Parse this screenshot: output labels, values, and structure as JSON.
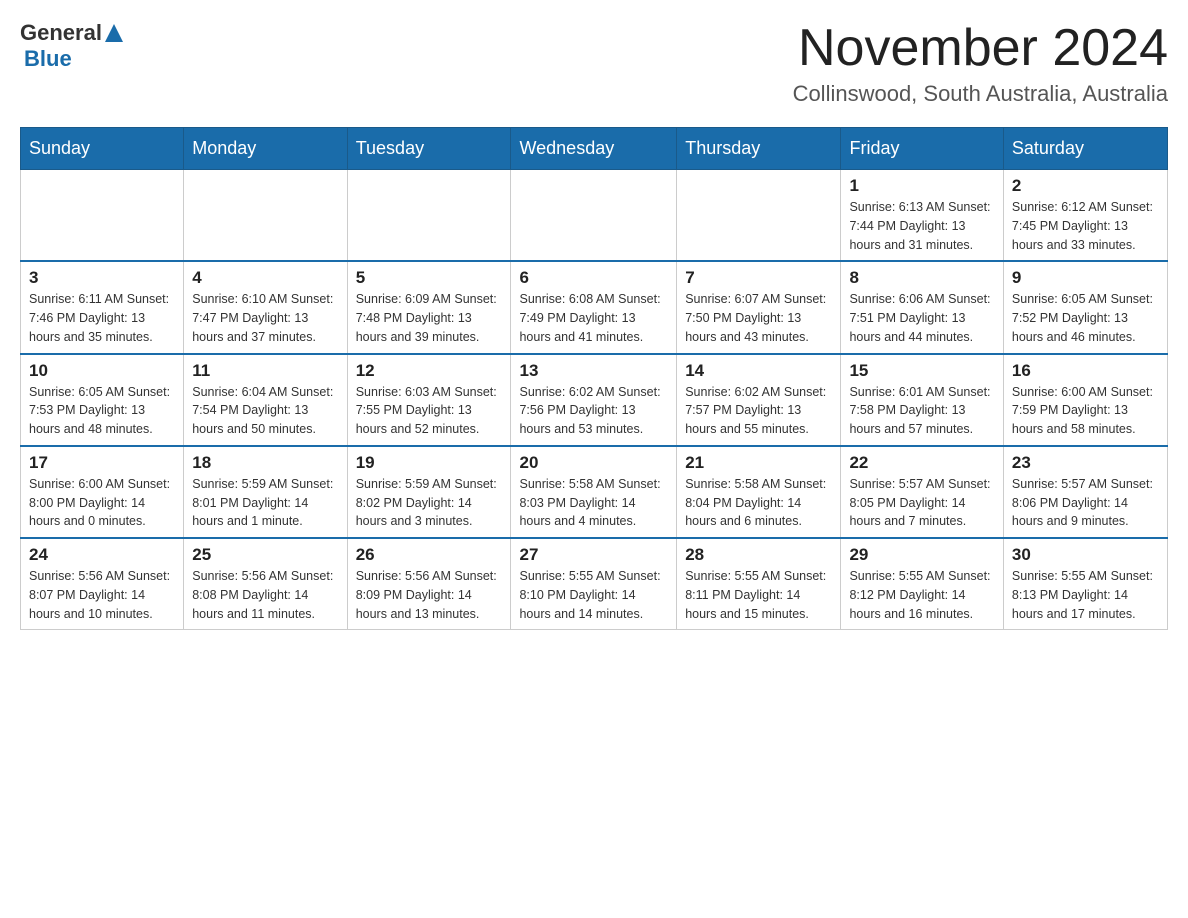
{
  "logo": {
    "general": "General",
    "triangle": "▶",
    "blue": "Blue"
  },
  "title": "November 2024",
  "location": "Collinswood, South Australia, Australia",
  "days_header": [
    "Sunday",
    "Monday",
    "Tuesday",
    "Wednesday",
    "Thursday",
    "Friday",
    "Saturday"
  ],
  "weeks": [
    {
      "cells": [
        {
          "day": "",
          "info": ""
        },
        {
          "day": "",
          "info": ""
        },
        {
          "day": "",
          "info": ""
        },
        {
          "day": "",
          "info": ""
        },
        {
          "day": "",
          "info": ""
        },
        {
          "day": "1",
          "info": "Sunrise: 6:13 AM\nSunset: 7:44 PM\nDaylight: 13 hours\nand 31 minutes."
        },
        {
          "day": "2",
          "info": "Sunrise: 6:12 AM\nSunset: 7:45 PM\nDaylight: 13 hours\nand 33 minutes."
        }
      ]
    },
    {
      "cells": [
        {
          "day": "3",
          "info": "Sunrise: 6:11 AM\nSunset: 7:46 PM\nDaylight: 13 hours\nand 35 minutes."
        },
        {
          "day": "4",
          "info": "Sunrise: 6:10 AM\nSunset: 7:47 PM\nDaylight: 13 hours\nand 37 minutes."
        },
        {
          "day": "5",
          "info": "Sunrise: 6:09 AM\nSunset: 7:48 PM\nDaylight: 13 hours\nand 39 minutes."
        },
        {
          "day": "6",
          "info": "Sunrise: 6:08 AM\nSunset: 7:49 PM\nDaylight: 13 hours\nand 41 minutes."
        },
        {
          "day": "7",
          "info": "Sunrise: 6:07 AM\nSunset: 7:50 PM\nDaylight: 13 hours\nand 43 minutes."
        },
        {
          "day": "8",
          "info": "Sunrise: 6:06 AM\nSunset: 7:51 PM\nDaylight: 13 hours\nand 44 minutes."
        },
        {
          "day": "9",
          "info": "Sunrise: 6:05 AM\nSunset: 7:52 PM\nDaylight: 13 hours\nand 46 minutes."
        }
      ]
    },
    {
      "cells": [
        {
          "day": "10",
          "info": "Sunrise: 6:05 AM\nSunset: 7:53 PM\nDaylight: 13 hours\nand 48 minutes."
        },
        {
          "day": "11",
          "info": "Sunrise: 6:04 AM\nSunset: 7:54 PM\nDaylight: 13 hours\nand 50 minutes."
        },
        {
          "day": "12",
          "info": "Sunrise: 6:03 AM\nSunset: 7:55 PM\nDaylight: 13 hours\nand 52 minutes."
        },
        {
          "day": "13",
          "info": "Sunrise: 6:02 AM\nSunset: 7:56 PM\nDaylight: 13 hours\nand 53 minutes."
        },
        {
          "day": "14",
          "info": "Sunrise: 6:02 AM\nSunset: 7:57 PM\nDaylight: 13 hours\nand 55 minutes."
        },
        {
          "day": "15",
          "info": "Sunrise: 6:01 AM\nSunset: 7:58 PM\nDaylight: 13 hours\nand 57 minutes."
        },
        {
          "day": "16",
          "info": "Sunrise: 6:00 AM\nSunset: 7:59 PM\nDaylight: 13 hours\nand 58 minutes."
        }
      ]
    },
    {
      "cells": [
        {
          "day": "17",
          "info": "Sunrise: 6:00 AM\nSunset: 8:00 PM\nDaylight: 14 hours\nand 0 minutes."
        },
        {
          "day": "18",
          "info": "Sunrise: 5:59 AM\nSunset: 8:01 PM\nDaylight: 14 hours\nand 1 minute."
        },
        {
          "day": "19",
          "info": "Sunrise: 5:59 AM\nSunset: 8:02 PM\nDaylight: 14 hours\nand 3 minutes."
        },
        {
          "day": "20",
          "info": "Sunrise: 5:58 AM\nSunset: 8:03 PM\nDaylight: 14 hours\nand 4 minutes."
        },
        {
          "day": "21",
          "info": "Sunrise: 5:58 AM\nSunset: 8:04 PM\nDaylight: 14 hours\nand 6 minutes."
        },
        {
          "day": "22",
          "info": "Sunrise: 5:57 AM\nSunset: 8:05 PM\nDaylight: 14 hours\nand 7 minutes."
        },
        {
          "day": "23",
          "info": "Sunrise: 5:57 AM\nSunset: 8:06 PM\nDaylight: 14 hours\nand 9 minutes."
        }
      ]
    },
    {
      "cells": [
        {
          "day": "24",
          "info": "Sunrise: 5:56 AM\nSunset: 8:07 PM\nDaylight: 14 hours\nand 10 minutes."
        },
        {
          "day": "25",
          "info": "Sunrise: 5:56 AM\nSunset: 8:08 PM\nDaylight: 14 hours\nand 11 minutes."
        },
        {
          "day": "26",
          "info": "Sunrise: 5:56 AM\nSunset: 8:09 PM\nDaylight: 14 hours\nand 13 minutes."
        },
        {
          "day": "27",
          "info": "Sunrise: 5:55 AM\nSunset: 8:10 PM\nDaylight: 14 hours\nand 14 minutes."
        },
        {
          "day": "28",
          "info": "Sunrise: 5:55 AM\nSunset: 8:11 PM\nDaylight: 14 hours\nand 15 minutes."
        },
        {
          "day": "29",
          "info": "Sunrise: 5:55 AM\nSunset: 8:12 PM\nDaylight: 14 hours\nand 16 minutes."
        },
        {
          "day": "30",
          "info": "Sunrise: 5:55 AM\nSunset: 8:13 PM\nDaylight: 14 hours\nand 17 minutes."
        }
      ]
    }
  ]
}
